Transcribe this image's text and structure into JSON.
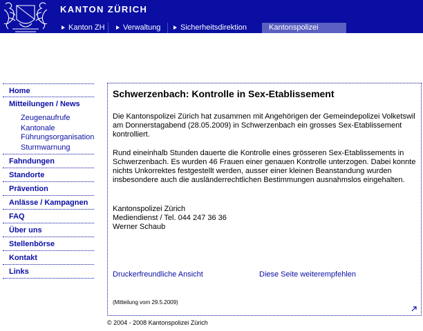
{
  "header": {
    "title": "KANTON ZÜRICH",
    "colors": {
      "primary": "#0a0ea3",
      "active_crumb": "#5a5fc0"
    }
  },
  "breadcrumb": [
    {
      "label": "Kanton ZH"
    },
    {
      "label": "Verwaltung"
    },
    {
      "label": "Sicherheitsdirektion"
    },
    {
      "label": "Kantonspolizei"
    }
  ],
  "nav": {
    "items": [
      {
        "label": "Home"
      },
      {
        "label": "Mitteilungen / News"
      },
      {
        "label": "Fahndungen"
      },
      {
        "label": "Standorte"
      },
      {
        "label": "Prävention"
      },
      {
        "label": "Anlässe / Kampagnen"
      },
      {
        "label": "FAQ"
      },
      {
        "label": "Über uns"
      },
      {
        "label": "Stellenbörse"
      },
      {
        "label": "Kontakt"
      },
      {
        "label": "Links"
      }
    ],
    "subitems": [
      {
        "label": "Zeugenaufrufe"
      },
      {
        "label_line1": "Kantonale",
        "label_line2": "Führungsorganisation"
      },
      {
        "label": "Sturmwarnung"
      }
    ]
  },
  "article": {
    "title": "Schwerzenbach: Kontrolle in Sex-Etablissement",
    "p1": "Die Kantonspolizei Zürich hat zusammen mit Angehörigen der Gemeindepolizei Volketswil am Donnerstagabend (28.05.2009) in Schwerzenbach ein grosses Sex-Etablissement kontrolliert.",
    "p2": "Rund eineinhalb Stunden dauerte die Kontrolle eines grösseren Sex-Etablissements in Schwerzenbach. Es wurden 46 Frauen einer genauen Kontrolle unterzogen. Dabei konnte nichts Unkorrektes festgestellt werden, ausser einer kleinen Beanstandung wurden insbesondere auch die ausländerrechtlichen Bestimmungen ausnahmslos eingehalten.",
    "contact_line1": "Kantonspolizei Zürich",
    "contact_line2": "Mediendienst / Tel. 044 247 36 36",
    "contact_line3": "Werner Schaub",
    "print_link": "Druckerfreundliche Ansicht",
    "recommend_link": "Diese Seite weiterempfehlen",
    "date_note": "(Mitteilung vom 29.5.2009)"
  },
  "footer": {
    "copyright": "© 2004 - 2008 Kantonspolizei Zürich"
  }
}
